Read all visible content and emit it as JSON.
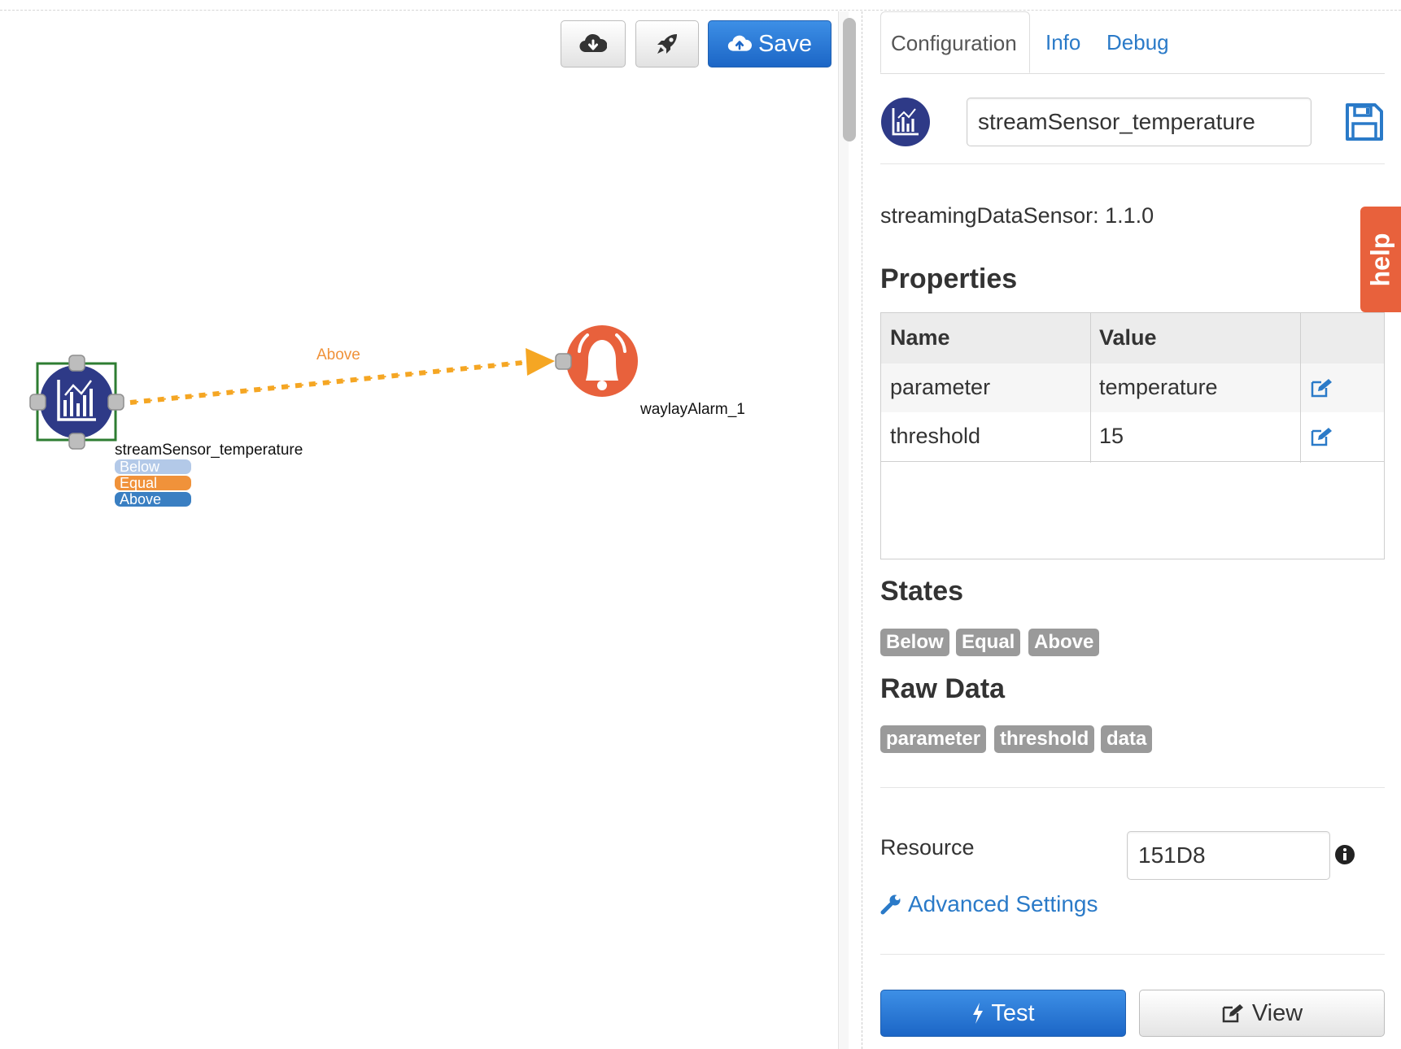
{
  "toolbar": {
    "download_icon": "cloud-download-icon",
    "deploy_icon": "rocket-icon",
    "save_label": "Save"
  },
  "graph": {
    "sensor_node": {
      "label": "streamSensor_temperature",
      "icon": "chart-icon",
      "states": [
        {
          "label": "Below",
          "color": "#b3c9e8"
        },
        {
          "label": "Equal",
          "color": "#f0923a"
        },
        {
          "label": "Above",
          "color": "#3a7fc2"
        }
      ]
    },
    "alarm_node": {
      "label": "waylayAlarm_1",
      "icon": "bell-icon",
      "color": "#e8613c"
    },
    "edge": {
      "label": "Above",
      "color": "#f5a623"
    }
  },
  "panel": {
    "tabs": [
      {
        "label": "Configuration",
        "active": true
      },
      {
        "label": "Info",
        "active": false
      },
      {
        "label": "Debug",
        "active": false
      }
    ],
    "node_name": "streamSensor_temperature",
    "sensor_version": "streamingDataSensor: 1.1.0",
    "properties_heading": "Properties",
    "table": {
      "headers": [
        "Name",
        "Value"
      ],
      "rows": [
        {
          "name": "parameter",
          "value": "temperature"
        },
        {
          "name": "threshold",
          "value": "15"
        }
      ]
    },
    "states_heading": "States",
    "states": [
      "Below",
      "Equal",
      "Above"
    ],
    "raw_data_heading": "Raw Data",
    "raw_data": [
      "parameter",
      "threshold",
      "data"
    ],
    "resource_label": "Resource",
    "resource_value": "151D8",
    "advanced_settings": "Advanced Settings",
    "test_label": "Test",
    "view_label": "View",
    "help_label": "help"
  },
  "colors": {
    "primary": "#1c66c6",
    "link": "#2a7ac8",
    "sensor_node": "#2e3a87",
    "alarm_node": "#e8613c",
    "badge": "#9a9a9a"
  }
}
